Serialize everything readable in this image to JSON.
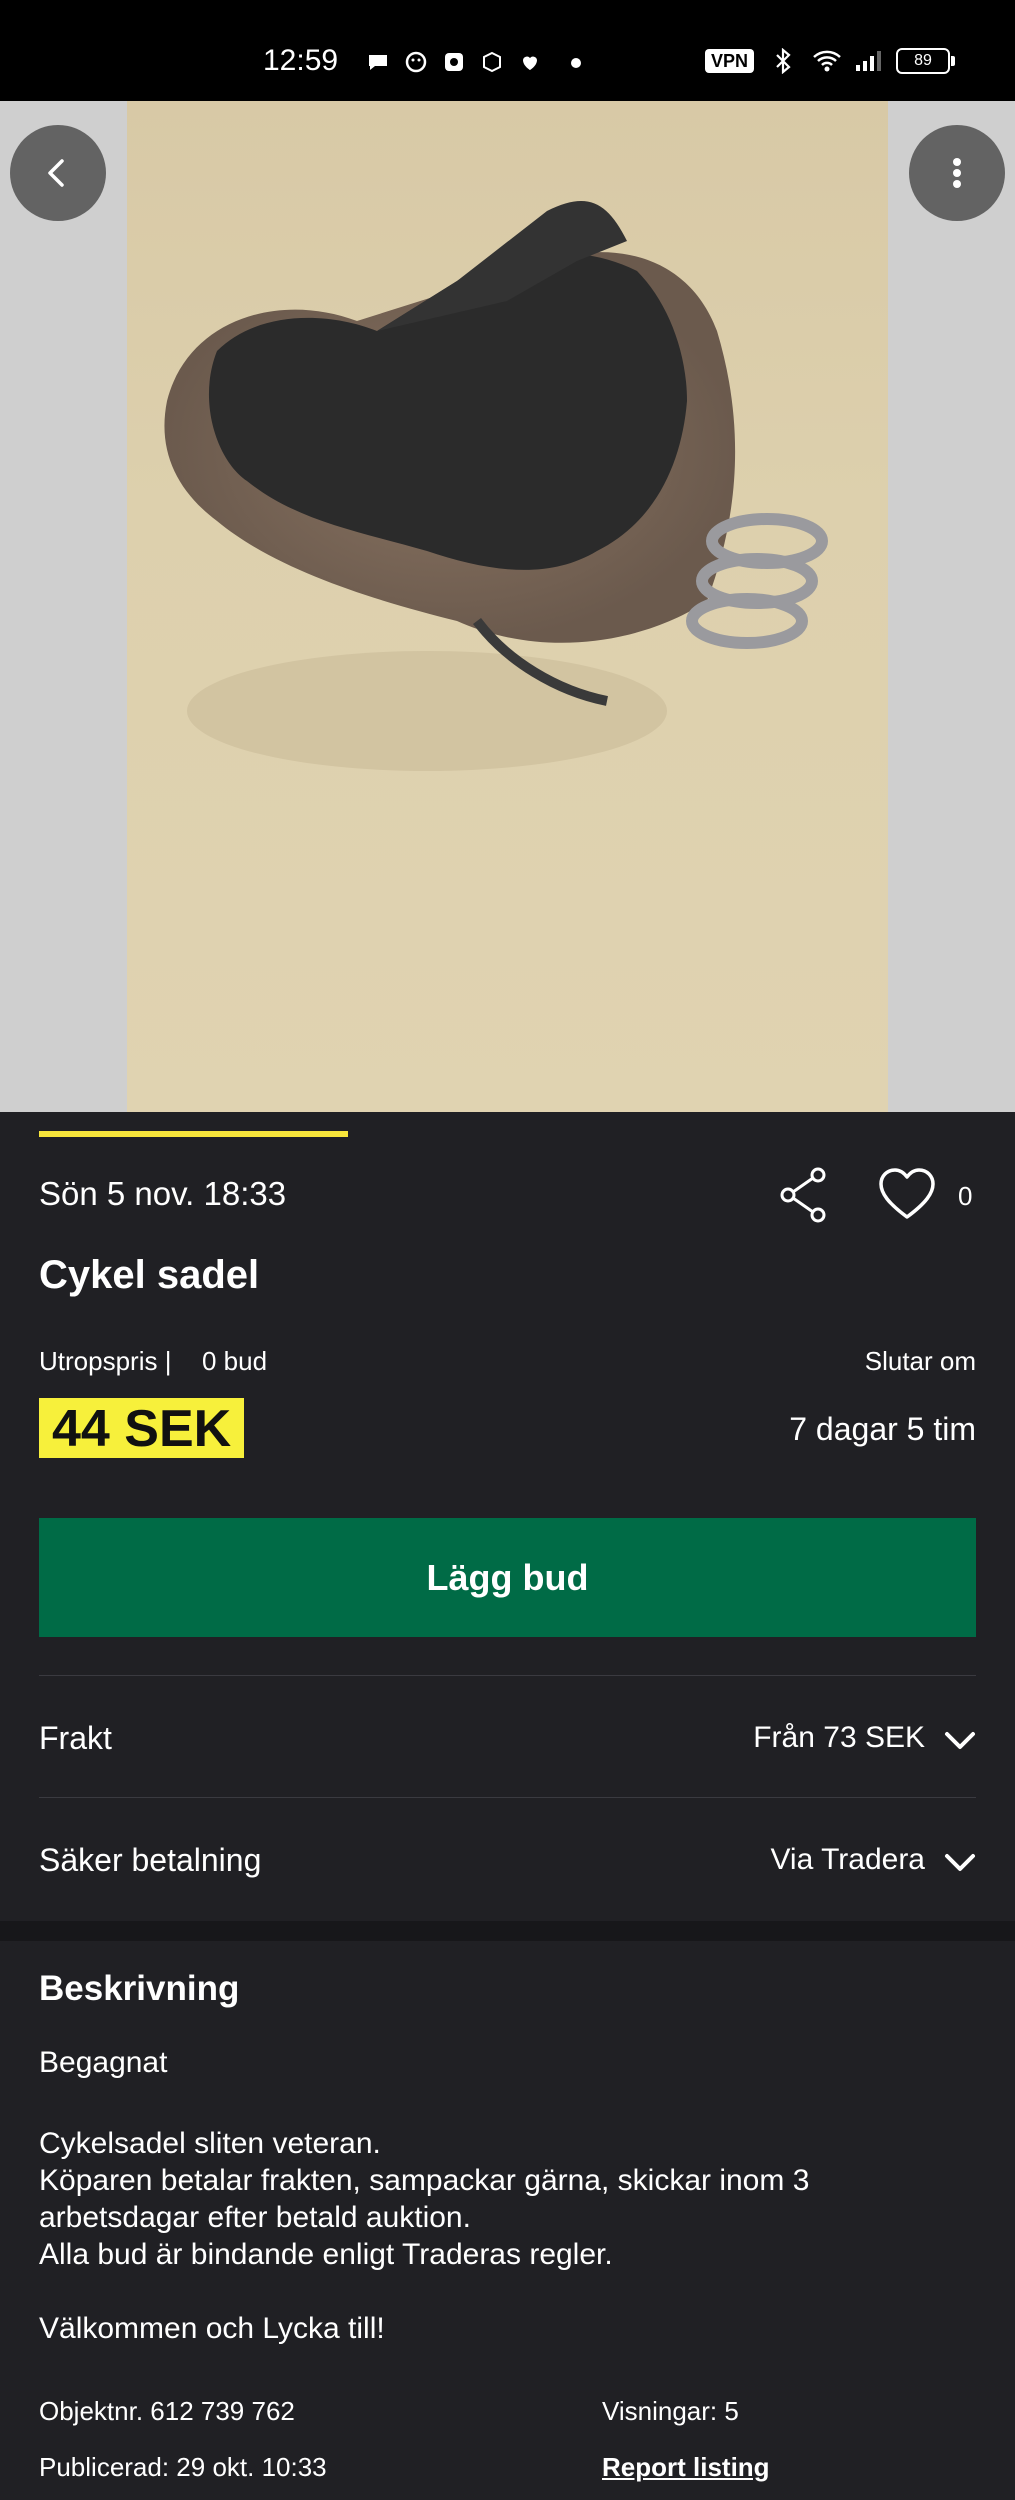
{
  "status_bar": {
    "time": "12:59",
    "vpn": "VPN",
    "battery": "89"
  },
  "listing": {
    "date": "Sön 5 nov. 18:33",
    "likes": "0",
    "title": "Cykel sadel",
    "startprice_label": "Utropspris",
    "bids": "0 bud",
    "ends_label": "Slutar om",
    "price": "44 SEK",
    "time_left": "7 dagar 5 tim",
    "image_progress": 0.33,
    "accent_color": "#f7e53b",
    "button_color": "#006b46"
  },
  "actions": {
    "bid_button": "Lägg bud"
  },
  "shipping": {
    "label": "Frakt",
    "value": "Från 73 SEK"
  },
  "payment": {
    "label": "Säker betalning",
    "value": "Via Tradera"
  },
  "description": {
    "heading": "Beskrivning",
    "condition": "Begagnat",
    "lines": [
      "Cykelsadel sliten veteran.",
      "Köparen betalar frakten, sampackar gärna, skickar inom 3 arbetsdagar efter betald auktion.",
      "Alla bud är bindande enligt Traderas regler."
    ],
    "welcome": "Välkommen och Lycka till!"
  },
  "meta": {
    "object_number": "Objektnr. 612 739 762",
    "views": "Visningar: 5",
    "published": "Publicerad: 29 okt. 10:33",
    "report": "Report listing"
  },
  "icons": {
    "back": "chevron-left-icon",
    "menu": "more-vertical-icon",
    "share": "share-icon",
    "favorite": "heart-icon",
    "expand": "chevron-down-icon"
  }
}
